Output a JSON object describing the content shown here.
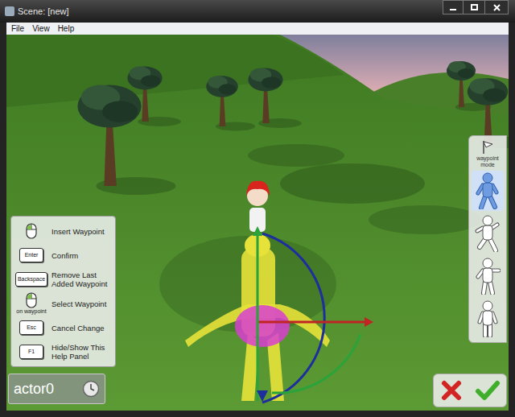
{
  "window": {
    "title": "Scene: [new]"
  },
  "menu": [
    "File",
    "View",
    "Help"
  ],
  "help_panel": {
    "items": [
      {
        "kind": "mouse",
        "label": "Insert Waypoint"
      },
      {
        "kind": "key",
        "key": "Enter",
        "label": "Confirm"
      },
      {
        "kind": "key",
        "key": "Backspace",
        "label": "Remove Last Added Waypoint"
      },
      {
        "kind": "mouse",
        "note": "on waypoint",
        "label": "Select Waypoint"
      },
      {
        "kind": "key",
        "key": "Esc",
        "label": "Cancel Change"
      },
      {
        "kind": "key",
        "key": "F1",
        "label": "Hide/Show This Help Panel"
      }
    ]
  },
  "actor": {
    "name": "actor0"
  },
  "toolbar": {
    "mode_label": "waypoint mode",
    "tools": [
      {
        "selected": true
      },
      {
        "selected": false
      },
      {
        "selected": false
      },
      {
        "selected": false
      }
    ]
  }
}
